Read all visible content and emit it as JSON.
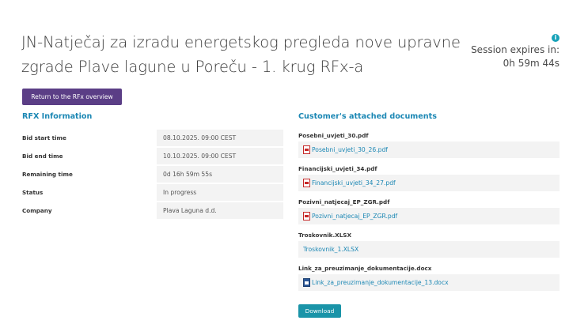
{
  "page": {
    "title": "JN-Natječaj za izradu energetskog pregleda nove upravne zgrade Plave lagune u Poreču - 1. krug RFx-a"
  },
  "session": {
    "label": "Session expires in:",
    "time": "0h 59m 44s",
    "icon": "info-icon",
    "icon_color": "#17a2b8"
  },
  "actions": {
    "return_label": "Return to the RFx overview",
    "download_label": "Download"
  },
  "rfx_info": {
    "title": "RFX Information",
    "rows": [
      {
        "label": "Bid start time",
        "value": "08.10.2025. 09:00 CEST"
      },
      {
        "label": "Bid end time",
        "value": "10.10.2025. 09:00 CEST"
      },
      {
        "label": "Remaining time",
        "value": "0d 16h 59m 55s"
      },
      {
        "label": "Status",
        "value": "In progress"
      },
      {
        "label": "Company",
        "value": "Plava Laguna d.d."
      }
    ]
  },
  "documents": {
    "title": "Customer's attached documents",
    "items": [
      {
        "name": "Posebni_uvjeti_30.pdf",
        "file": "Posebni_uvjeti_30_26.pdf",
        "icon": "pdf-icon"
      },
      {
        "name": "Financijski_uvjeti_34.pdf",
        "file": "Financijski_uvjeti_34_27.pdf",
        "icon": "pdf-icon"
      },
      {
        "name": "Pozivni_natjecaj_EP_ZGR.pdf",
        "file": "Pozivni_natjecaj_EP_ZGR.pdf",
        "icon": "pdf-icon"
      },
      {
        "name": "Troskovnik.XLSX",
        "file": "Troskovnik_1.XLSX",
        "icon": ""
      },
      {
        "name": "Link_za_preuzimanje_dokumentacije.docx",
        "file": "Link_za_preuzimanje_dokumentacije_13.docx",
        "icon": "word-doc-icon"
      }
    ]
  },
  "colors": {
    "primary_button": "#5b3e86",
    "download_button": "#1a94a8",
    "section_title": "#1b87b4",
    "link": "#1b87b4"
  }
}
